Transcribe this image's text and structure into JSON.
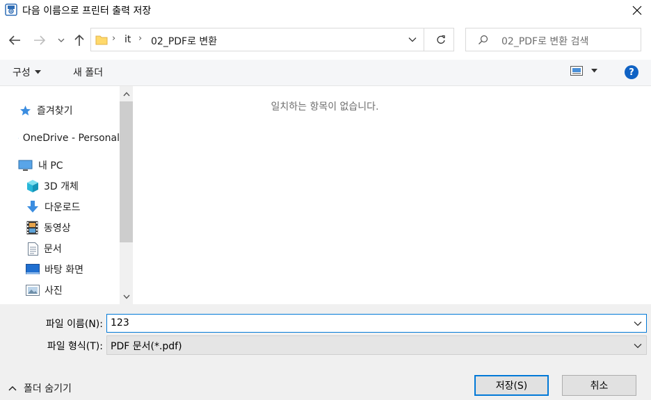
{
  "window": {
    "title": "다음 이름으로 프린터 출력 저장"
  },
  "address": {
    "breadcrumb": [
      "it",
      "02_PDF로 변환"
    ],
    "separator": "›"
  },
  "search": {
    "placeholder": "02_PDF로 변환 검색"
  },
  "toolbar": {
    "organize_label": "구성",
    "new_folder_label": "새 폴더",
    "help_label": "?"
  },
  "sidebar": {
    "items": [
      {
        "label": "즐겨찾기",
        "icon": "star-icon"
      },
      {
        "label": "OneDrive - Personal",
        "icon": "onedrive-cloud-icon"
      },
      {
        "label": "내 PC",
        "icon": "computer-icon"
      },
      {
        "label": "3D 개체",
        "icon": "cube-3d-icon"
      },
      {
        "label": "다운로드",
        "icon": "download-arrow-icon"
      },
      {
        "label": "동영상",
        "icon": "film-icon"
      },
      {
        "label": "문서",
        "icon": "document-icon"
      },
      {
        "label": "바탕 화면",
        "icon": "desktop-icon"
      },
      {
        "label": "사진",
        "icon": "picture-icon"
      }
    ]
  },
  "content": {
    "empty_message": "일치하는 항목이 없습니다."
  },
  "form": {
    "filename_label": "파일 이름(N):",
    "filename_value": "123",
    "filetype_label": "파일 형식(T):",
    "filetype_value": "PDF 문서(*.pdf)"
  },
  "footer": {
    "hide_folders_label": "폴더 숨기기",
    "save_label": "저장(S)",
    "cancel_label": "취소"
  },
  "colors": {
    "accent": "#0078d7",
    "folder": "#ffd96b",
    "panel": "#f0f0f0"
  }
}
